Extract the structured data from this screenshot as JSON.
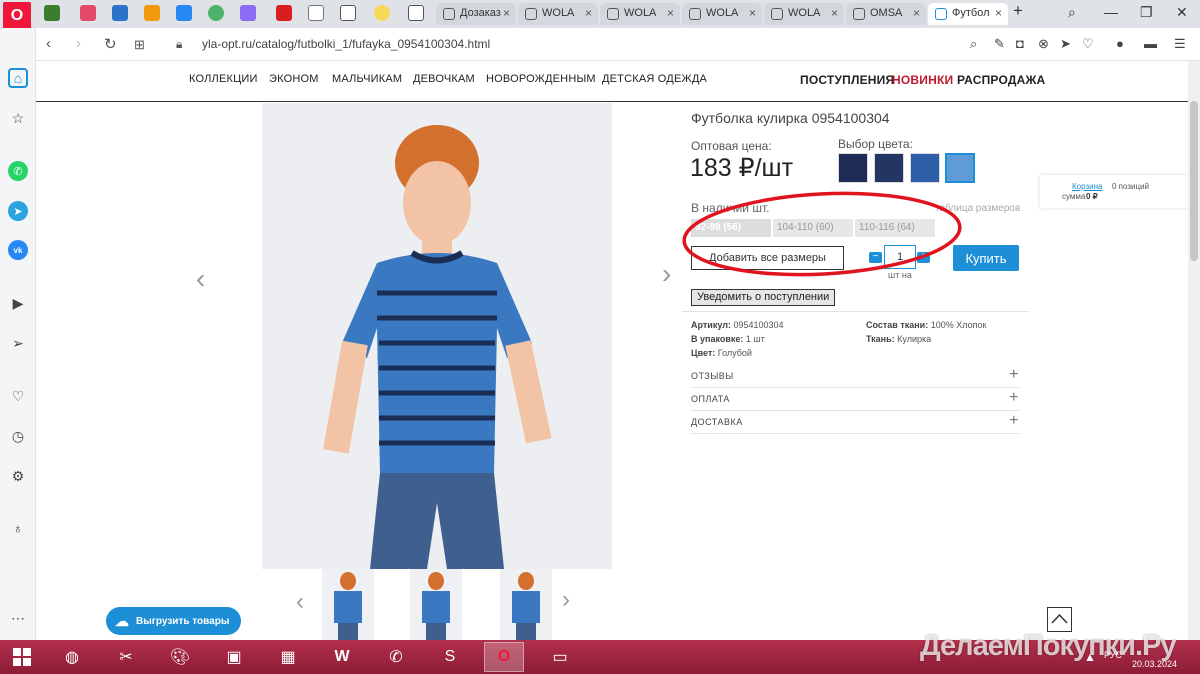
{
  "browser": {
    "tabs": [
      {
        "label": "Дозаказ"
      },
      {
        "label": "WOLA"
      },
      {
        "label": "WOLA"
      },
      {
        "label": "WOLA"
      },
      {
        "label": "WOLA"
      },
      {
        "label": "OMSA"
      },
      {
        "label": "Футбол",
        "active": true
      }
    ],
    "url": "yla-opt.ru/catalog/futbolki_1/fufayka_0954100304.html",
    "opera_logo": "O"
  },
  "site": {
    "nav_left": [
      "КОЛЛЕКЦИИ",
      "ЭКОНОМ",
      "МАЛЬЧИКАМ",
      "ДЕВОЧКАМ",
      "НОВОРОЖДЕННЫМ",
      "ДЕТСКАЯ ОДЕЖДА"
    ],
    "nav_right": [
      {
        "label": "ПОСТУПЛЕНИЯ",
        "color": "#222222"
      },
      {
        "label": "НОВИНКИ",
        "color": "#c0182e"
      },
      {
        "label": "РАСПРОДАЖА",
        "color": "#222222"
      }
    ]
  },
  "product": {
    "title": "Футболка кулирка 0954100304",
    "price_label": "Оптовая цена:",
    "price": "183 ₽/шт",
    "color_label": "Выбор цвета:",
    "stock_label": "В наличии шт.",
    "size_table_link": "таблица размеров",
    "sizes": [
      {
        "label": "92-98 (56)",
        "selected": true
      },
      {
        "label": "104-110 (60)",
        "selected": false
      },
      {
        "label": "110-116 (64)",
        "selected": false
      }
    ],
    "add_all_label": "Добавить все размеры",
    "qty_value": "1",
    "qty_unit": "шт на",
    "buy_label": "Купить",
    "notify_label": "Уведомить о поступлении",
    "specs": {
      "article_label": "Артикул:",
      "article": "0954100304",
      "pack_label": "В упаковке:",
      "pack": "1 шт",
      "color_label": "Цвет:",
      "color": "Голубой",
      "fabric_comp_label": "Состав ткани:",
      "fabric_comp": "100% Хлопок",
      "fabric_label": "Ткань:",
      "fabric": "Кулирка"
    },
    "accordion": [
      "ОТЗЫВЫ",
      "ОПЛАТА",
      "ДОСТАВКА"
    ]
  },
  "cart": {
    "label": "Корзина",
    "positions": "0 позиций",
    "sum_label": "сумма",
    "sum": "0 ₽"
  },
  "export_button": "Выгрузить товары",
  "taskbar": {
    "watermark": "ДелаемПокупки.Ру",
    "lang": "РУС",
    "date": "20.03.2024"
  },
  "colors": {
    "accent": "#1c8fd6",
    "annotation": "#e0141e",
    "novinki": "#c0182e",
    "taskbar": "#a1243f"
  }
}
